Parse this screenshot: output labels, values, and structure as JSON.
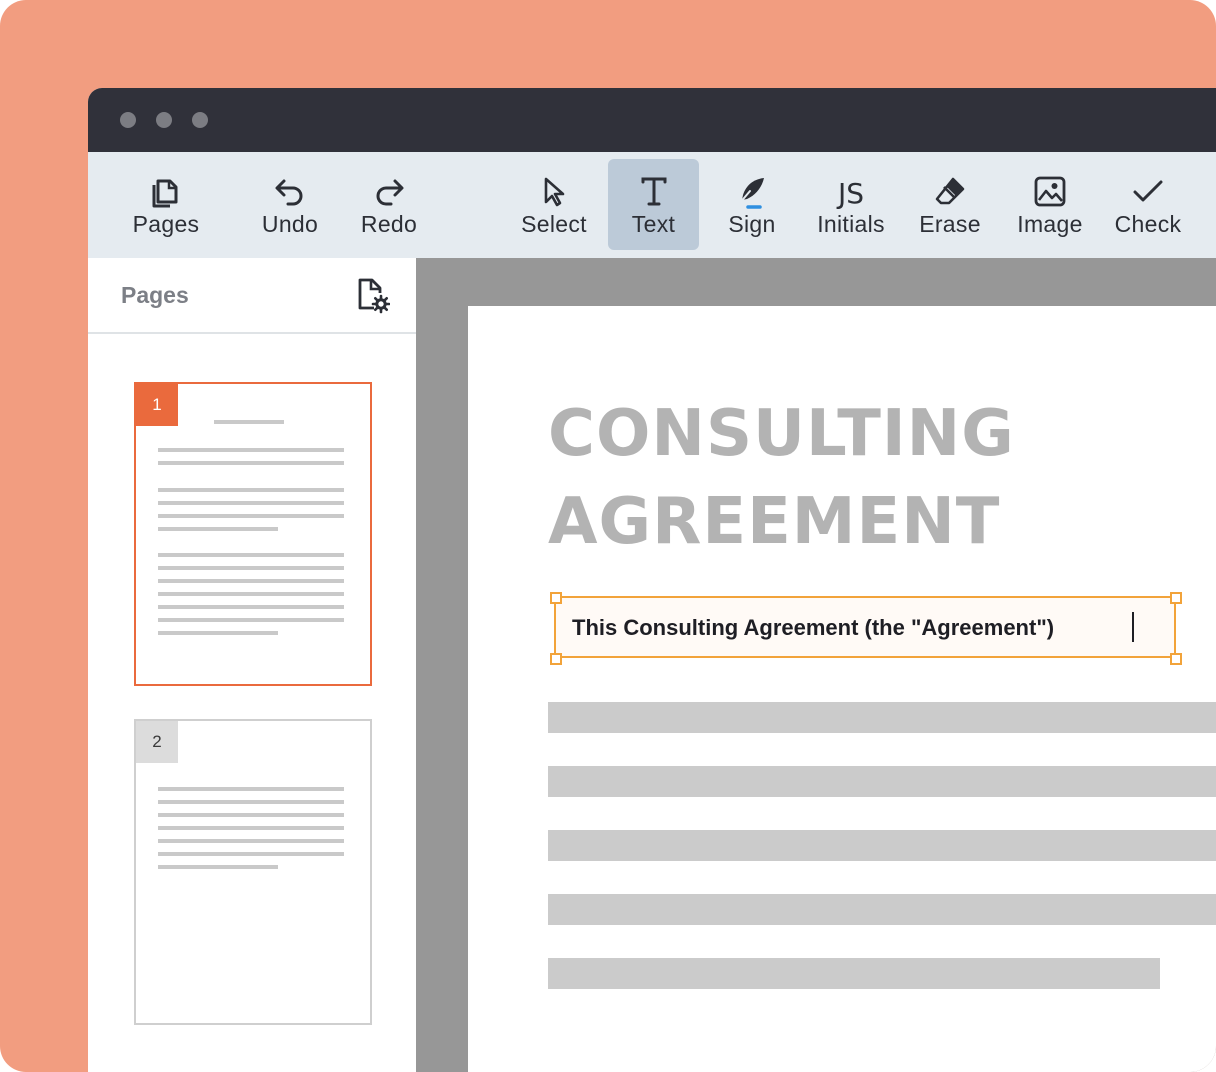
{
  "toolbar": {
    "items": [
      {
        "label": "Pages",
        "icon": "pages-icon"
      },
      {
        "label": "Undo",
        "icon": "undo-icon"
      },
      {
        "label": "Redo",
        "icon": "redo-icon"
      },
      {
        "label": "Select",
        "icon": "cursor-icon"
      },
      {
        "label": "Text",
        "icon": "text-icon",
        "active": true
      },
      {
        "label": "Sign",
        "icon": "feather-pen-icon"
      },
      {
        "label": "Initials",
        "icon": "initials-icon",
        "glyph": "JS"
      },
      {
        "label": "Erase",
        "icon": "eraser-icon"
      },
      {
        "label": "Image",
        "icon": "image-icon"
      },
      {
        "label": "Check",
        "icon": "checkmark-icon"
      }
    ]
  },
  "sidebar": {
    "title": "Pages",
    "thumbnails": [
      {
        "number": "1",
        "selected": true
      },
      {
        "number": "2",
        "selected": false
      }
    ]
  },
  "document": {
    "title": "CONSULTING\nAGREEMENT",
    "text_field_value": "This Consulting Agreement (the \"Agreement\")"
  },
  "colors": {
    "frame_background": "#f29d80",
    "title_bar": "#30313a",
    "toolbar": "#e5ebf0",
    "active_tool": "#bccad8",
    "selected_accent": "#ea6a3d",
    "text_box_border": "#f2a33a",
    "sign_underline": "#2f8fe0"
  }
}
